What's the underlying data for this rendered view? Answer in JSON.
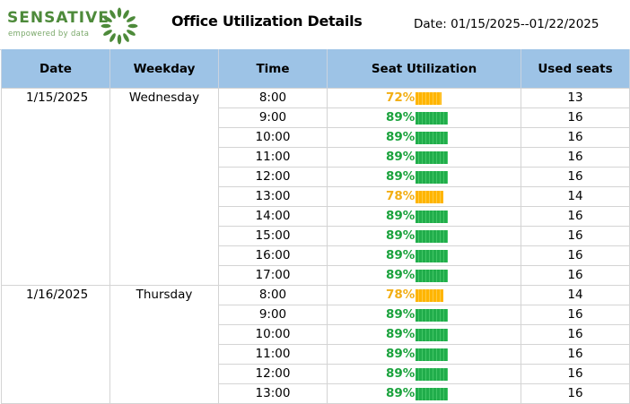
{
  "brand": {
    "name": "SENSATIVE",
    "tagline": "empowered by data"
  },
  "title": "Office Utilization Details",
  "date_range": "Date: 01/15/2025--01/22/2025",
  "colors": {
    "high": "#21ad4b",
    "medium": "#ffb500",
    "header": "#9dc3e6",
    "brand": "#4d8a3a"
  },
  "table": {
    "headers": [
      "Date",
      "Weekday",
      "Time",
      "Seat Utilization",
      "Used seats"
    ],
    "groups": [
      {
        "date": "1/15/2025",
        "weekday": "Wednesday",
        "rows": [
          {
            "time": "8:00",
            "pct": "72%",
            "level": 0.72,
            "seats": "13"
          },
          {
            "time": "9:00",
            "pct": "89%",
            "level": 0.89,
            "seats": "16"
          },
          {
            "time": "10:00",
            "pct": "89%",
            "level": 0.89,
            "seats": "16"
          },
          {
            "time": "11:00",
            "pct": "89%",
            "level": 0.89,
            "seats": "16"
          },
          {
            "time": "12:00",
            "pct": "89%",
            "level": 0.89,
            "seats": "16"
          },
          {
            "time": "13:00",
            "pct": "78%",
            "level": 0.78,
            "seats": "14"
          },
          {
            "time": "14:00",
            "pct": "89%",
            "level": 0.89,
            "seats": "16"
          },
          {
            "time": "15:00",
            "pct": "89%",
            "level": 0.89,
            "seats": "16"
          },
          {
            "time": "16:00",
            "pct": "89%",
            "level": 0.89,
            "seats": "16"
          },
          {
            "time": "17:00",
            "pct": "89%",
            "level": 0.89,
            "seats": "16"
          }
        ]
      },
      {
        "date": "1/16/2025",
        "weekday": "Thursday",
        "rows": [
          {
            "time": "8:00",
            "pct": "78%",
            "level": 0.78,
            "seats": "14"
          },
          {
            "time": "9:00",
            "pct": "89%",
            "level": 0.89,
            "seats": "16"
          },
          {
            "time": "10:00",
            "pct": "89%",
            "level": 0.89,
            "seats": "16"
          },
          {
            "time": "11:00",
            "pct": "89%",
            "level": 0.89,
            "seats": "16"
          },
          {
            "time": "12:00",
            "pct": "89%",
            "level": 0.89,
            "seats": "16"
          },
          {
            "time": "13:00",
            "pct": "89%",
            "level": 0.89,
            "seats": "16"
          }
        ]
      }
    ]
  }
}
